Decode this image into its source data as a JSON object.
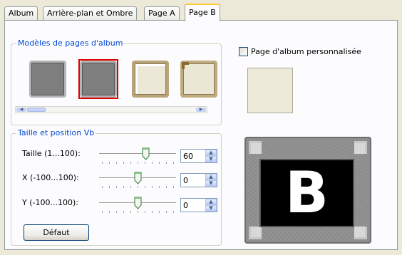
{
  "tabs": [
    {
      "label": "Album",
      "active": false
    },
    {
      "label": "Arrière-plan et Ombre",
      "active": false
    },
    {
      "label": "Page A",
      "active": false
    },
    {
      "label": "Page B",
      "active": true
    }
  ],
  "templates_group": {
    "title": "Modèles de pages d'album",
    "thumbnails": [
      {
        "style": "gray-frame",
        "selected": false
      },
      {
        "style": "gray-frame",
        "selected": true
      },
      {
        "style": "cream-frame",
        "selected": false
      },
      {
        "style": "cream-corner-frame",
        "selected": false
      }
    ],
    "selected_color": "#e00000"
  },
  "custom_page": {
    "label": "Page d'album personnalisée",
    "checked": false
  },
  "size_group": {
    "title": "Taille et position Vb",
    "rows": [
      {
        "label": "Taille (1...100):",
        "value": "60",
        "slider_fraction": 0.6
      },
      {
        "label": "X (-100...100):",
        "value": "0",
        "slider_fraction": 0.5
      },
      {
        "label": "Y (-100...100):",
        "value": "0",
        "slider_fraction": 0.5
      }
    ],
    "default_button": "Défaut"
  },
  "preview": {
    "letter": "B"
  },
  "colors": {
    "group_title": "#0046d5",
    "active_tab_accent": "#ffc83c"
  }
}
